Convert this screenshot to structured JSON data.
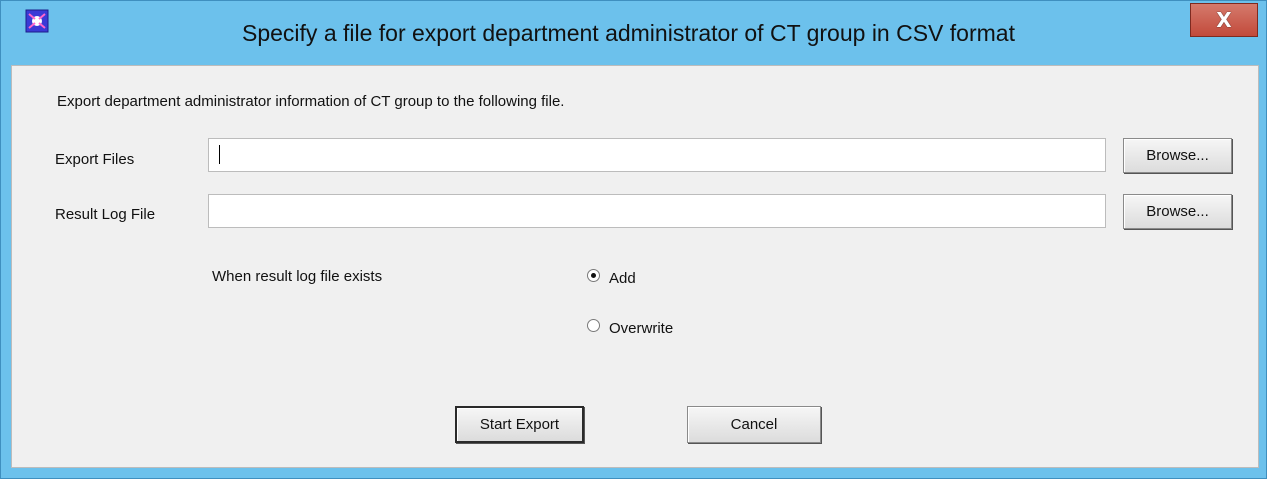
{
  "window": {
    "title": "Specify a file for export department administrator of CT group in CSV format",
    "close_label": "X",
    "app_icon": "app-icon"
  },
  "dialog": {
    "description": "Export department administrator information of CT group to the following file.",
    "export_files_label": "Export Files",
    "export_files_value": "",
    "result_log_label": "Result Log File",
    "result_log_value": "",
    "browse_label": "Browse...",
    "when_exists_label": "When result log file exists",
    "options": [
      {
        "label": "Add",
        "selected": true
      },
      {
        "label": "Overwrite",
        "selected": false
      }
    ],
    "start_label": "Start Export",
    "cancel_label": "Cancel"
  }
}
